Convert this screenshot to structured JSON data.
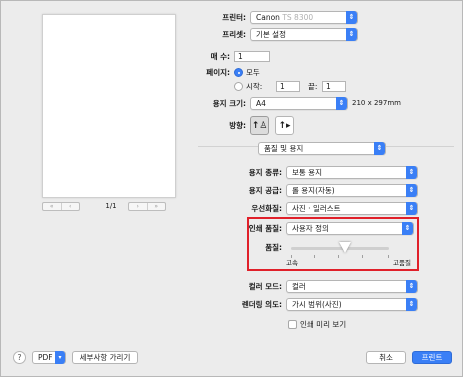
{
  "printer": {
    "label": "프린터:",
    "value": "Canon",
    "value_model": "TS 8300"
  },
  "presets": {
    "label": "프리셋:",
    "value": "기본 설정"
  },
  "copies": {
    "label": "매 수:",
    "value": "1"
  },
  "pages": {
    "label": "페이지:",
    "all_label": "모두",
    "from_label": "시작:",
    "from_value": "1",
    "to_label": "끝:",
    "to_value": "1",
    "selected": "all"
  },
  "paper_size": {
    "label": "용지 크기:",
    "value": "A4",
    "dims": "210 x 297mm"
  },
  "orientation": {
    "label": "방향:",
    "portrait_icon": "portrait-person-icon",
    "landscape_icon": "landscape-person-icon",
    "selected": "portrait"
  },
  "section": {
    "value": "품질 및 용지"
  },
  "media_type": {
    "label": "용지 종류:",
    "value": "보통 용지"
  },
  "paper_source": {
    "label": "용지 공급:",
    "value": "롤 용지(자동)"
  },
  "priority": {
    "label": "우선화질:",
    "value": "사진 · 일러스트"
  },
  "print_quality": {
    "label": "인쇄 품질:",
    "value": "사용자 정의"
  },
  "quality": {
    "label": "품질:",
    "min_label": "고속",
    "max_label": "고품질",
    "level": 0.55
  },
  "color_mode": {
    "label": "컬러 모드:",
    "value": "컬러"
  },
  "rendering": {
    "label": "렌더링 의도:",
    "value": "가시 범위(사진)"
  },
  "grayscale": {
    "label": "인쇄 미리 보기",
    "checked": false
  },
  "preview": {
    "page_counter": "1/1"
  },
  "footer": {
    "help": "?",
    "pdf": "PDF",
    "hide_details": "세부사항 가리기",
    "cancel": "취소",
    "print": "프린트"
  },
  "colors": {
    "accent": "#3a7ff6",
    "highlight": "#e0202a"
  }
}
